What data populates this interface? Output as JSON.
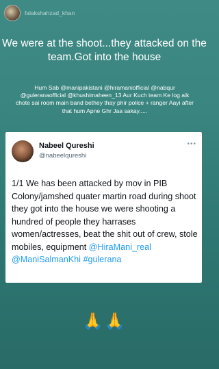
{
  "story": {
    "username": "falakshahzad_khan",
    "headline": "We were at the shoot...they attacked on the team.Got into the house",
    "caption": "Hum Sab @manipakistani @hiramaniofficial @nabqur @guleranaofficial @khushimaheen_13 Aur Kuch team Ke log aik chote sai room main band bethey thay phir police + ranger Aayi after that hum Apne Ghr Jaa sakay.....",
    "emoji": "🙏🙏"
  },
  "tweet": {
    "name": "Nabeel Qureshi",
    "handle": "@nabeelqureshi",
    "more": "•••",
    "text_main": "1/1 We has been attacked by mov in PIB Colony/jamshed quater martin road during shoot they got into the house we were shooting a hundred of people they harrases women/actresses, beat the shit out of crew, stole mobiles, equipment ",
    "mention_1": "@HiraMani_real",
    "mention_2": "@ManiSalmanKhi",
    "hashtag": "#gulerana"
  }
}
